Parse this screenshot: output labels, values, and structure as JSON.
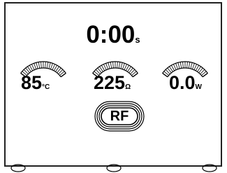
{
  "timer": {
    "value": "0:00",
    "unit": "s"
  },
  "gauges": [
    {
      "id": "temperature",
      "value": "85",
      "unit": "°C"
    },
    {
      "id": "impedance",
      "value": "225",
      "unit": "Ω"
    },
    {
      "id": "power",
      "value": "0.0",
      "unit": "W"
    }
  ],
  "rf_button": {
    "label": "RF"
  },
  "softkeys": [
    "left-softkey",
    "center-softkey",
    "right-softkey"
  ],
  "colors": {
    "foreground": "#000000",
    "background": "#ffffff",
    "frame": "#222222"
  }
}
